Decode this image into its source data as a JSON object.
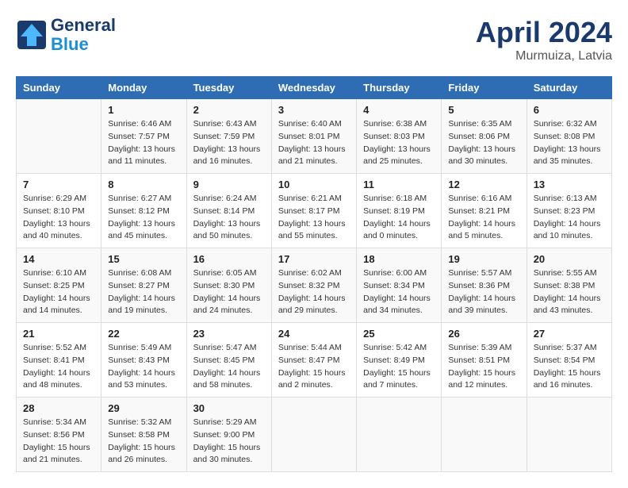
{
  "header": {
    "logo_line1": "General",
    "logo_line2": "Blue",
    "month_year": "April 2024",
    "location": "Murmuiza, Latvia"
  },
  "calendar": {
    "days_of_week": [
      "Sunday",
      "Monday",
      "Tuesday",
      "Wednesday",
      "Thursday",
      "Friday",
      "Saturday"
    ],
    "weeks": [
      [
        {
          "day": "",
          "info": ""
        },
        {
          "day": "1",
          "info": "Sunrise: 6:46 AM\nSunset: 7:57 PM\nDaylight: 13 hours\nand 11 minutes."
        },
        {
          "day": "2",
          "info": "Sunrise: 6:43 AM\nSunset: 7:59 PM\nDaylight: 13 hours\nand 16 minutes."
        },
        {
          "day": "3",
          "info": "Sunrise: 6:40 AM\nSunset: 8:01 PM\nDaylight: 13 hours\nand 21 minutes."
        },
        {
          "day": "4",
          "info": "Sunrise: 6:38 AM\nSunset: 8:03 PM\nDaylight: 13 hours\nand 25 minutes."
        },
        {
          "day": "5",
          "info": "Sunrise: 6:35 AM\nSunset: 8:06 PM\nDaylight: 13 hours\nand 30 minutes."
        },
        {
          "day": "6",
          "info": "Sunrise: 6:32 AM\nSunset: 8:08 PM\nDaylight: 13 hours\nand 35 minutes."
        }
      ],
      [
        {
          "day": "7",
          "info": "Sunrise: 6:29 AM\nSunset: 8:10 PM\nDaylight: 13 hours\nand 40 minutes."
        },
        {
          "day": "8",
          "info": "Sunrise: 6:27 AM\nSunset: 8:12 PM\nDaylight: 13 hours\nand 45 minutes."
        },
        {
          "day": "9",
          "info": "Sunrise: 6:24 AM\nSunset: 8:14 PM\nDaylight: 13 hours\nand 50 minutes."
        },
        {
          "day": "10",
          "info": "Sunrise: 6:21 AM\nSunset: 8:17 PM\nDaylight: 13 hours\nand 55 minutes."
        },
        {
          "day": "11",
          "info": "Sunrise: 6:18 AM\nSunset: 8:19 PM\nDaylight: 14 hours\nand 0 minutes."
        },
        {
          "day": "12",
          "info": "Sunrise: 6:16 AM\nSunset: 8:21 PM\nDaylight: 14 hours\nand 5 minutes."
        },
        {
          "day": "13",
          "info": "Sunrise: 6:13 AM\nSunset: 8:23 PM\nDaylight: 14 hours\nand 10 minutes."
        }
      ],
      [
        {
          "day": "14",
          "info": "Sunrise: 6:10 AM\nSunset: 8:25 PM\nDaylight: 14 hours\nand 14 minutes."
        },
        {
          "day": "15",
          "info": "Sunrise: 6:08 AM\nSunset: 8:27 PM\nDaylight: 14 hours\nand 19 minutes."
        },
        {
          "day": "16",
          "info": "Sunrise: 6:05 AM\nSunset: 8:30 PM\nDaylight: 14 hours\nand 24 minutes."
        },
        {
          "day": "17",
          "info": "Sunrise: 6:02 AM\nSunset: 8:32 PM\nDaylight: 14 hours\nand 29 minutes."
        },
        {
          "day": "18",
          "info": "Sunrise: 6:00 AM\nSunset: 8:34 PM\nDaylight: 14 hours\nand 34 minutes."
        },
        {
          "day": "19",
          "info": "Sunrise: 5:57 AM\nSunset: 8:36 PM\nDaylight: 14 hours\nand 39 minutes."
        },
        {
          "day": "20",
          "info": "Sunrise: 5:55 AM\nSunset: 8:38 PM\nDaylight: 14 hours\nand 43 minutes."
        }
      ],
      [
        {
          "day": "21",
          "info": "Sunrise: 5:52 AM\nSunset: 8:41 PM\nDaylight: 14 hours\nand 48 minutes."
        },
        {
          "day": "22",
          "info": "Sunrise: 5:49 AM\nSunset: 8:43 PM\nDaylight: 14 hours\nand 53 minutes."
        },
        {
          "day": "23",
          "info": "Sunrise: 5:47 AM\nSunset: 8:45 PM\nDaylight: 14 hours\nand 58 minutes."
        },
        {
          "day": "24",
          "info": "Sunrise: 5:44 AM\nSunset: 8:47 PM\nDaylight: 15 hours\nand 2 minutes."
        },
        {
          "day": "25",
          "info": "Sunrise: 5:42 AM\nSunset: 8:49 PM\nDaylight: 15 hours\nand 7 minutes."
        },
        {
          "day": "26",
          "info": "Sunrise: 5:39 AM\nSunset: 8:51 PM\nDaylight: 15 hours\nand 12 minutes."
        },
        {
          "day": "27",
          "info": "Sunrise: 5:37 AM\nSunset: 8:54 PM\nDaylight: 15 hours\nand 16 minutes."
        }
      ],
      [
        {
          "day": "28",
          "info": "Sunrise: 5:34 AM\nSunset: 8:56 PM\nDaylight: 15 hours\nand 21 minutes."
        },
        {
          "day": "29",
          "info": "Sunrise: 5:32 AM\nSunset: 8:58 PM\nDaylight: 15 hours\nand 26 minutes."
        },
        {
          "day": "30",
          "info": "Sunrise: 5:29 AM\nSunset: 9:00 PM\nDaylight: 15 hours\nand 30 minutes."
        },
        {
          "day": "",
          "info": ""
        },
        {
          "day": "",
          "info": ""
        },
        {
          "day": "",
          "info": ""
        },
        {
          "day": "",
          "info": ""
        }
      ]
    ]
  }
}
